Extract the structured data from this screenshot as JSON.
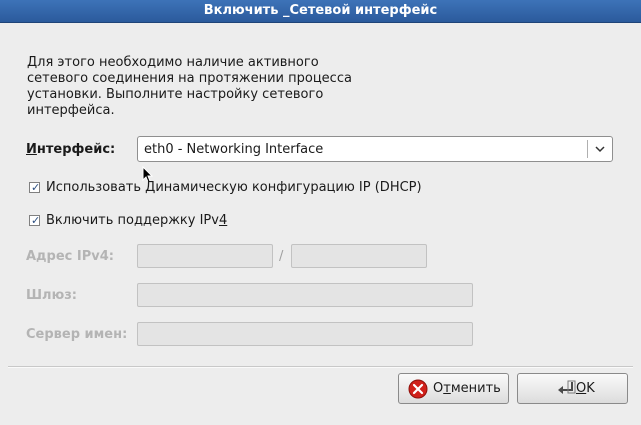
{
  "window": {
    "title": "Включить _Сетевой интерфейс"
  },
  "description": "Для этого необходимо наличие активного\nсетевого соединения на протяжении процесса\nустановки. Выполните настройку сетевого\nинтерфейса.",
  "interface": {
    "label_u": "И",
    "label_rest": "нтерфейс:",
    "selected": "eth0 - Networking Interface"
  },
  "dhcp": {
    "checked": true,
    "label_pre": "Использовать ",
    "label_u": "Д",
    "label_post": "инамическую конфигурацию IP (DHCP)"
  },
  "ipv4": {
    "checked": true,
    "label_pre": "Включить поддержку IPv",
    "label_u": "4"
  },
  "fields": {
    "ipv4_address_label": "Адрес IPv4:",
    "slash": "/",
    "gateway_label": "Шлюз:",
    "nameserver_label": "Сервер имен:"
  },
  "buttons": {
    "cancel_pre": "О",
    "cancel_u": "т",
    "cancel_post": "менить",
    "ok_u": "О",
    "ok_post": "K"
  },
  "colors": {
    "titlebar": "#2b5a9c",
    "cancel_icon": "#d0201a"
  }
}
